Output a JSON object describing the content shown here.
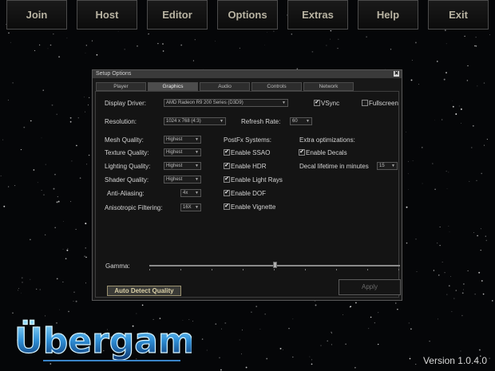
{
  "topnav": [
    "Join",
    "Host",
    "Editor",
    "Options",
    "Extras",
    "Help",
    "Exit"
  ],
  "dialog": {
    "title": "Setup Options",
    "close_glyph": "✖",
    "tabs": [
      "Player",
      "Graphics",
      "Audio",
      "Controls",
      "Network"
    ],
    "active_tab": "Graphics",
    "display_driver": {
      "label": "Display Driver:",
      "value": "AMD Radeon R9 200 Series (D3D9)"
    },
    "vsync": {
      "label": "VSync",
      "checked": true
    },
    "fullscreen": {
      "label": "Fullscreen",
      "checked": false
    },
    "resolution": {
      "label": "Resolution:",
      "value": "1024 x 768 (4:3)"
    },
    "refresh_rate": {
      "label": "Refresh Rate:",
      "value": "60"
    },
    "quality": [
      {
        "label": "Mesh Quality:",
        "value": "Highest"
      },
      {
        "label": "Texture Quality:",
        "value": "Highest"
      },
      {
        "label": "Lighting Quality:",
        "value": "Highest"
      },
      {
        "label": "Shader Quality:",
        "value": "Highest"
      },
      {
        "label": "Anti-Aliasing:",
        "value": "4x"
      },
      {
        "label": "Anisotropic Filtering:",
        "value": "16X"
      }
    ],
    "postfx": {
      "title": "PostFx Systems:",
      "items": [
        {
          "label": "Enable SSAO",
          "checked": true
        },
        {
          "label": "Enable HDR",
          "checked": true
        },
        {
          "label": "Enable Light Rays",
          "checked": true
        },
        {
          "label": "Enable DOF",
          "checked": true
        },
        {
          "label": "Enable Vignette",
          "checked": true
        }
      ]
    },
    "extra": {
      "title": "Extra optimizations:",
      "decals": {
        "label": "Enable Decals",
        "checked": true
      },
      "decal_lifetime": {
        "label": "Decal lifetime in minutes",
        "value": "15"
      }
    },
    "gamma": {
      "label": "Gamma:",
      "value": 0.5
    },
    "auto_detect_label": "Auto Detect Quality",
    "apply_label": "Apply",
    "check_glyph": "✔",
    "arrow_glyph": "▼"
  },
  "logo_text": "Übergame",
  "version": "Version 1.0.4.0"
}
